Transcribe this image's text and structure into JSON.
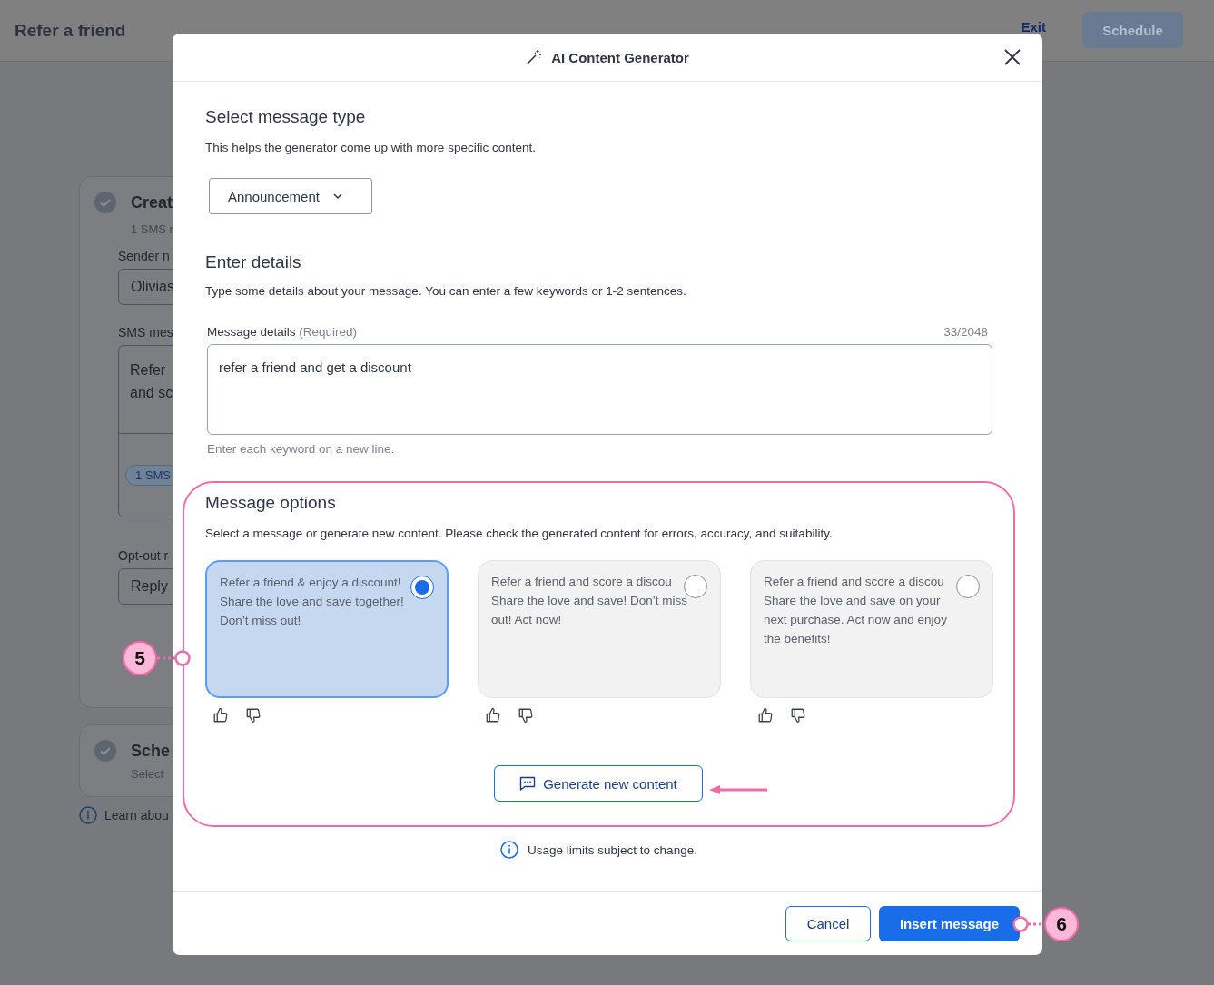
{
  "page": {
    "title": "Refer a friend",
    "exit": "Exit",
    "schedule": "Schedule",
    "steps": [
      {
        "kind": "create",
        "done": true,
        "title": "Creat",
        "subtitle": "1 SMS r",
        "sender_label": "Sender n",
        "sender_value": "Olivias",
        "sms_label": "SMS mes",
        "sms_lines": [
          "Refer",
          "and sc"
        ],
        "sms_badge": "1 SMS",
        "optout_label": "Opt-out r",
        "optout_value": "Reply"
      },
      {
        "kind": "schedule",
        "done": true,
        "title": "Sche",
        "subtitle": "Select"
      }
    ],
    "learn": "Learn abou"
  },
  "dialog": {
    "title": "AI Content Generator",
    "type_section": {
      "heading": "Select message type",
      "description": "This helps the generator come up with more specific content.",
      "dropdown": "Announcement"
    },
    "details_section": {
      "heading": "Enter details",
      "description": "Type some details about your message. You can enter a few keywords or 1-2 sentences.",
      "label": "Message details",
      "required": "(Required)",
      "counter": "33/2048",
      "value": "refer a friend and get a discount",
      "hint": "Enter each keyword on a new line."
    },
    "options_section": {
      "heading": "Message options",
      "description": "Select a message or generate new content. Please check the generated content for errors, accuracy, and suitability.",
      "options": [
        {
          "lines": [
            "Refer a friend & enjoy a discount!",
            "Share the love and save together!",
            "Don’t miss out!"
          ],
          "selected": true
        },
        {
          "lines": [
            "Refer a friend and score a discou",
            "Share the love and save! Don’t miss",
            "out! Act now!"
          ],
          "selected": false
        },
        {
          "lines": [
            "Refer a friend and score a discou",
            "Share the love and save on your",
            "next purchase. Act now and enjoy",
            "the benefits!"
          ],
          "selected": false
        }
      ],
      "generate": "Generate new content"
    },
    "usage_note": "Usage limits subject to change.",
    "cancel": "Cancel",
    "insert": "Insert message"
  },
  "callouts": [
    {
      "number": "5"
    },
    {
      "number": "6"
    }
  ]
}
